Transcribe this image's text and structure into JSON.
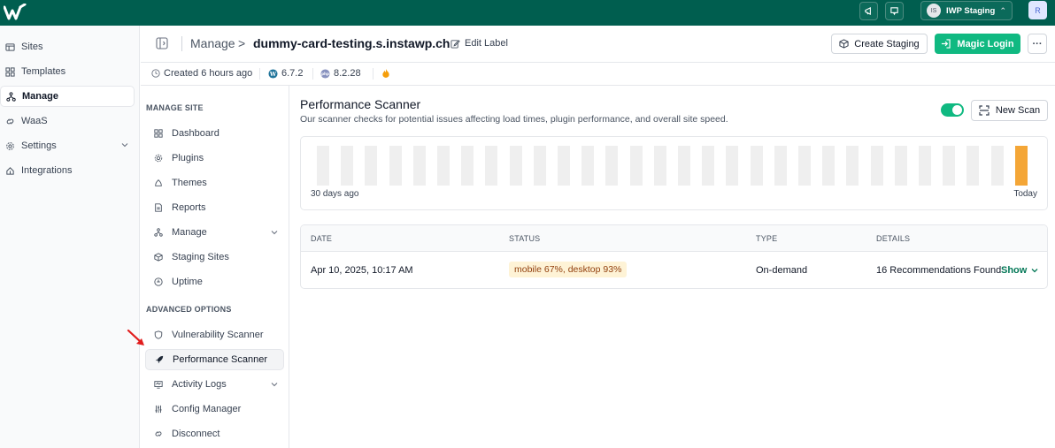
{
  "topbar": {
    "team_avatar": "IS",
    "team_name": "IWP Staging",
    "user_avatar": "R",
    "colors": {
      "background": "#005e4f"
    },
    "icons": [
      "logo-icon",
      "announcement-icon",
      "feedback-icon",
      "chevron-updown-icon"
    ]
  },
  "sidebar": {
    "items": [
      {
        "label": "Sites",
        "icon": "sites-icon"
      },
      {
        "label": "Templates",
        "icon": "templates-icon"
      },
      {
        "label": "Manage",
        "icon": "manage-icon",
        "active": true
      },
      {
        "label": "WaaS",
        "icon": "waas-icon"
      },
      {
        "label": "Settings",
        "icon": "settings-icon",
        "expandable": true
      },
      {
        "label": "Integrations",
        "icon": "integrations-icon"
      }
    ]
  },
  "header": {
    "breadcrumb_root": "Manage",
    "breadcrumb_sep": ">",
    "site_name": "dummy-card-testing.s.instawp.ch",
    "edit_label": "Edit Label",
    "create_staging": "Create Staging",
    "magic_login": "Magic Login",
    "more": "···"
  },
  "info": {
    "created": "Created 6 hours ago",
    "wp_version": "6.7.2",
    "php_version": "8.2.28"
  },
  "submenu": {
    "manage_heading": "MANAGE SITE",
    "manage_items": [
      {
        "label": "Dashboard",
        "icon": "dashboard-icon"
      },
      {
        "label": "Plugins",
        "icon": "plugins-icon"
      },
      {
        "label": "Themes",
        "icon": "themes-icon"
      },
      {
        "label": "Reports",
        "icon": "reports-icon"
      },
      {
        "label": "Manage",
        "icon": "manage-icon",
        "expandable": true
      },
      {
        "label": "Staging Sites",
        "icon": "staging-icon"
      },
      {
        "label": "Uptime",
        "icon": "uptime-icon"
      }
    ],
    "advanced_heading": "ADVANCED OPTIONS",
    "advanced_items": [
      {
        "label": "Vulnerability Scanner",
        "icon": "shield-icon"
      },
      {
        "label": "Performance Scanner",
        "icon": "rocket-icon",
        "active": true
      },
      {
        "label": "Activity Logs",
        "icon": "activity-icon",
        "expandable": true
      },
      {
        "label": "Config Manager",
        "icon": "sliders-icon"
      },
      {
        "label": "Disconnect",
        "icon": "link-icon"
      }
    ]
  },
  "main": {
    "title": "Performance Scanner",
    "description": "Our scanner checks for potential issues affecting load times, plugin performance, and overall site speed.",
    "toggle_on": true,
    "new_scan": "New Scan",
    "history": {
      "start_label": "30 days ago",
      "end_label": "Today",
      "bar_count": 30,
      "scanned_days": [
        30
      ],
      "colors": {
        "empty": "#efefef",
        "scanned": "#f4a637"
      }
    },
    "table": {
      "headers": [
        "DATE",
        "STATUS",
        "TYPE",
        "DETAILS"
      ],
      "rows": [
        {
          "date": "Apr 10, 2025, 10:17 AM",
          "status": "mobile 67%, desktop 93%",
          "type": "On-demand",
          "details": "16 Recommendations Found",
          "action": "Show"
        }
      ]
    }
  }
}
